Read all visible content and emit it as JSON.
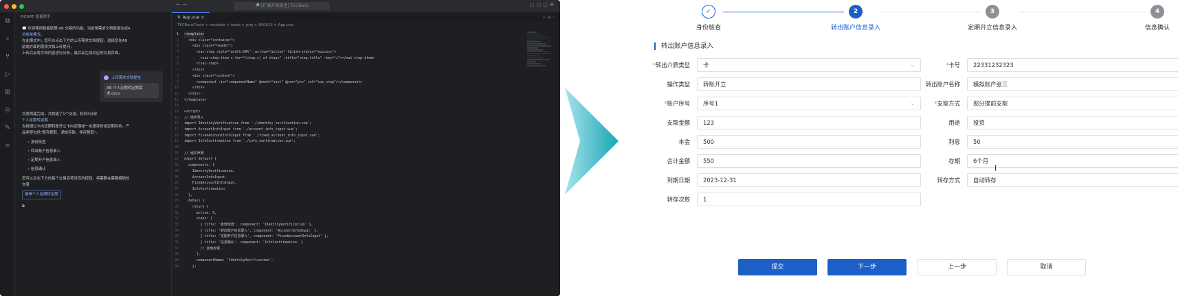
{
  "ide": {
    "window_title": "🔎 [扩展开发宿主] TECBank",
    "chat_header": "MCHAT: 智能助手",
    "chat_intro": [
      "💬 欢迎使用智能助理 AB 交易的功能。当前是需求文档智能生成A",
      "总结单模式。",
      "在此模式中，您可以点击下方的上传需求文档按钮，选择您在AB",
      "前端方面的需求文档上传提问，",
      "上传后会将文档内容进行分析，最后会生成对应的交易页面。"
    ],
    "user_msg": {
      "upload_label": "上传需求文档提交",
      "file_chip": "AB-个人定期转定期需求.docx"
    },
    "answer_lines": [
      "交易构建完成，共构建了1个交易。耗时6分钟",
      "个人定期转定期",
      "支持通过卡内定期转账开立卡内定期或一本通存折或定期存单，产",
      "品类型包括\"整存整取、通知存款、零存整取\"。"
    ],
    "answer_items": [
      "身份核查",
      "转出账户信息录入",
      "定期开户信息录入",
      "信息确认"
    ],
    "answer_tail": [
      "您可以点击下方的每个交易名称对应的按钮，将需要在需要编辑的",
      "交易"
    ],
    "tag_button": "编辑个人定期转定期",
    "tab_label": "App.vue",
    "breadcrumb": "TECBankTrade > modules > trade > proj > 800013 > App.vue",
    "code_lines": [
      "<template>",
      "  <div class=\"container\">",
      "    <div class=\"header\">",
      "      <sai-step style=\"width:50%\" :active=\"active\" finish-status=\"success\">",
      "        <sai-step-item v-for=\"(step,i) of steps\" :title=\"step.title\" :key=\"i\"></sai-step-item>",
      "      </sai-step>",
      "    </div>",
      "    <div class=\"content\">",
      "      <component :is=\"componentName\" @next=\"next\" @pre=\"pre\" ref=\"cus_step\"></component>",
      "    </div>",
      "  </div>",
      "</template>",
      "",
      "<script>",
      "// 组件导入",
      "import IdentityVerification from './identity_verification.vue';",
      "import AccountInfoInput from './account_info_input.vue';",
      "import FixedAccountInfoInput from './fixed_account_info_input.vue';",
      "import InfoConfirmation from './info_confirmation.vue';",
      "",
      "// 组件声明",
      "export default {",
      "  components: {",
      "    IdentityVerification,",
      "    AccountInfoInput,",
      "    FixedAccountInfoInput,",
      "    InfoConfirmation",
      "  },",
      "  data() {",
      "    return {",
      "      active: 0,",
      "      steps: [",
      "        { title: '身份核查', component: 'IdentityVerification' },",
      "        { title: '转出账户信息录入', component: 'AccountInfoInput' },",
      "        { title: '定期开户信息录入', component: 'FixedAccountInfoInput' },",
      "        { title: '信息确认', component: 'InfoConfirmation' }",
      "        // 其他步骤...",
      "      ],",
      "      componentName: 'IdentityVerification',",
      "    };"
    ]
  },
  "form": {
    "steps": [
      {
        "number": "✓",
        "label": "身份核查",
        "state": "done"
      },
      {
        "number": "2",
        "label": "转出账户信息录入",
        "state": "active"
      },
      {
        "number": "3",
        "label": "定期开立信息录入",
        "state": "pending"
      },
      {
        "number": "4",
        "label": "信息确认",
        "state": "pending"
      }
    ],
    "section_title": "转出账户信息录入",
    "fields": [
      {
        "label": "转出介质类型",
        "value": "卡",
        "required": true,
        "select": true
      },
      {
        "label": "卡号",
        "value": "22331232323",
        "required": true,
        "select": false
      },
      {
        "label": "操作类型",
        "value": "转账开立",
        "required": false,
        "select": false
      },
      {
        "label": "转出账户名称",
        "value": "模拟账户张三",
        "required": false,
        "select": false
      },
      {
        "label": "账户序号",
        "value": "序号1",
        "required": true,
        "select": true
      },
      {
        "label": "支取方式",
        "value": "部分提前支取",
        "required": true,
        "select": true
      },
      {
        "label": "支取金额",
        "value": "123",
        "required": false,
        "select": false
      },
      {
        "label": "用途",
        "value": "投资",
        "required": false,
        "select": true
      },
      {
        "label": "本金",
        "value": "500",
        "required": false,
        "select": false
      },
      {
        "label": "利息",
        "value": "50",
        "required": false,
        "select": false
      },
      {
        "label": "合计金额",
        "value": "550",
        "required": false,
        "select": false
      },
      {
        "label": "存期",
        "value": "6个月",
        "required": false,
        "select": false
      },
      {
        "label": "到期日期",
        "value": "2023-12-31",
        "required": false,
        "select": false
      },
      {
        "label": "转存方式",
        "value": "自动转存",
        "required": false,
        "select": false
      },
      {
        "label": "转存次数",
        "value": "1",
        "required": false,
        "select": false
      }
    ],
    "buttons": {
      "submit": "提交",
      "next": "下一步",
      "prev": "上一步",
      "cancel": "取消"
    }
  },
  "colors": {
    "primary": "#1d5fc7",
    "required": "#f56c6c",
    "arrow_start": "#a8e3ea",
    "arrow_end": "#16a6b6"
  }
}
